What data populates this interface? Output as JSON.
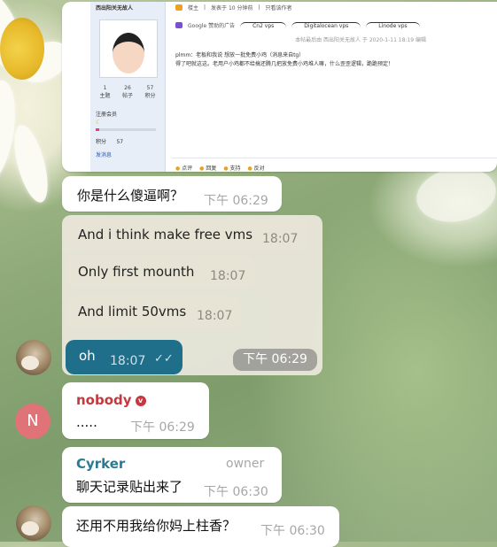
{
  "screenshot": {
    "user_title": "西出阳关无故人",
    "stats": [
      {
        "value": "1",
        "label": "主题"
      },
      {
        "value": "26",
        "label": "帖子"
      },
      {
        "value": "57",
        "label": "积分"
      }
    ],
    "member_label": "注册会员",
    "points_label": "积分",
    "points_value": "57",
    "send_message": "发消息",
    "header_role": "楼主",
    "header_posted": "发表于 10 分钟前",
    "header_author_only": "只看该作者",
    "ad_label": "Google 赞助的广告",
    "ad_tabs": [
      "Cn2 vps",
      "Digitalocean vps",
      "Linode vps"
    ],
    "edit_note": "本帖最后由 西出阳关无故人 于 2020-1-11 18:19 编辑",
    "body_line1": "plmm：老板和我说 想放一批免费小鸡（消息来自tg）",
    "body_line2": "得了吧就这这。老用户小鸡都不给搞还腾几把放免费小鸡堆人嘛，什么歪歪逻辑，跪跪预定！",
    "actions": [
      "点评",
      "回复",
      "支持",
      "反对"
    ]
  },
  "messages": [
    {
      "text": "你是什么傻逼啊？",
      "time": "下午 06:29"
    }
  ],
  "forwarded": [
    {
      "text": "And i think make free vms",
      "time": "18:07"
    },
    {
      "text": "Only first mounth",
      "time": "18:07"
    },
    {
      "text": "And limit 50vms",
      "time": "18:07"
    },
    {
      "text": "oh",
      "time": "18:07",
      "check": "✓✓"
    }
  ],
  "forwarded_group_time": "下午 06:29",
  "nobody_message": {
    "sender": "nobody",
    "verified_mark": "v",
    "text": ".....",
    "time": "下午 06:29",
    "avatar_letter": "N"
  },
  "cyrker_message": {
    "sender": "Cyrker",
    "role": "owner",
    "text": "聊天记录贴出来了",
    "time": "下午 06:30"
  },
  "last_message": {
    "text": "还用不用我给你妈上柱香？",
    "time": "下午 06:30"
  },
  "colors": {
    "accent_teal": "#2a7a95",
    "red_name": "#c6383d",
    "verified": "#c6383d",
    "nobody_avatar": "#e07378"
  }
}
